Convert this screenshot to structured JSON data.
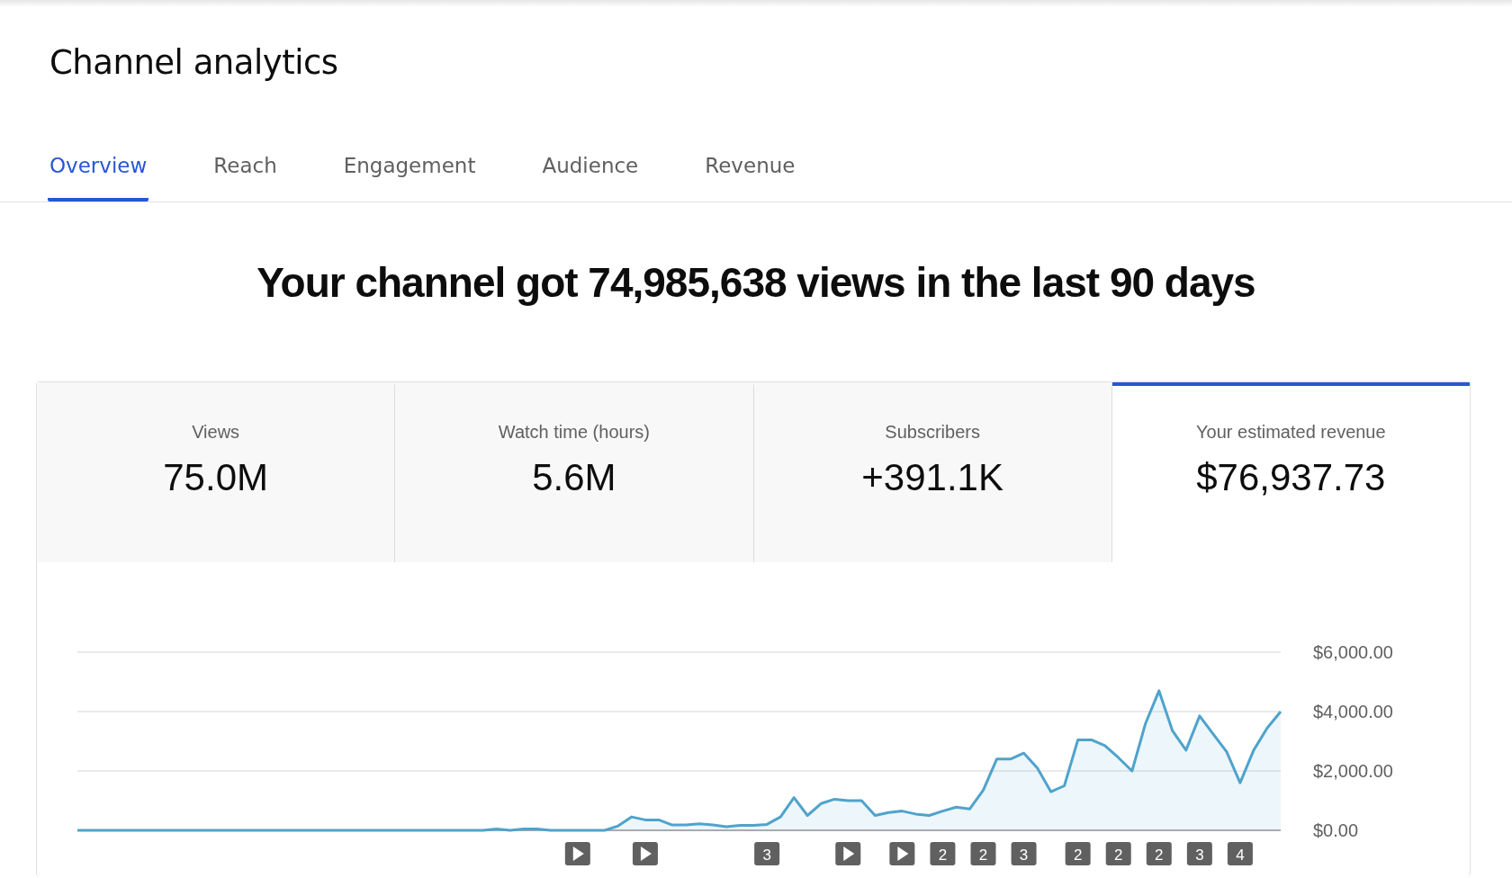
{
  "page": {
    "title": "Channel analytics"
  },
  "tabs": [
    {
      "label": "Overview",
      "selected": true
    },
    {
      "label": "Reach",
      "selected": false
    },
    {
      "label": "Engagement",
      "selected": false
    },
    {
      "label": "Audience",
      "selected": false
    },
    {
      "label": "Revenue",
      "selected": false
    }
  ],
  "headline": "Your channel got 74,985,638 views in the last 90 days",
  "metrics": [
    {
      "label": "Views",
      "value": "75.0M",
      "selected": false
    },
    {
      "label": "Watch time (hours)",
      "value": "5.6M",
      "selected": false
    },
    {
      "label": "Subscribers",
      "value": "+391.1K",
      "selected": false
    },
    {
      "label": "Your estimated revenue",
      "value": "$76,937.73",
      "selected": true
    }
  ],
  "chart": {
    "chart_data": {
      "type": "area",
      "ylim": [
        0,
        6000
      ],
      "yticks": [
        {
          "value": 0,
          "label": "$0.00"
        },
        {
          "value": 2000,
          "label": "$2,000.00"
        },
        {
          "value": 4000,
          "label": "$4,000.00"
        },
        {
          "value": 6000,
          "label": "$6,000.00"
        }
      ],
      "series": [
        {
          "color": "#4fa3cc",
          "values": [
            0,
            0,
            0,
            0,
            0,
            0,
            0,
            0,
            0,
            0,
            0,
            0,
            0,
            0,
            0,
            0,
            0,
            0,
            0,
            0,
            0,
            0,
            0,
            0,
            0,
            0,
            0,
            0,
            0,
            0,
            0,
            50,
            0,
            50,
            50,
            0,
            0,
            0,
            0,
            0,
            150,
            450,
            350,
            350,
            180,
            180,
            220,
            180,
            120,
            170,
            170,
            200,
            450,
            1100,
            500,
            900,
            1050,
            1000,
            1000,
            500,
            600,
            650,
            550,
            500,
            650,
            780,
            720,
            1350,
            2400,
            2400,
            2600,
            2100,
            1300,
            1500,
            3050,
            3050,
            2850,
            2450,
            2000,
            3600,
            4700,
            3350,
            2700,
            3850,
            3250,
            2650,
            1600,
            2700,
            3450,
            4000
          ]
        }
      ]
    },
    "markers": [
      {
        "kind": "video"
      },
      {
        "kind": "video"
      },
      {
        "kind": "count",
        "label": "3"
      },
      {
        "kind": "video"
      },
      {
        "kind": "video"
      },
      {
        "kind": "count",
        "label": "2"
      },
      {
        "kind": "count",
        "label": "2"
      },
      {
        "kind": "count",
        "label": "3"
      },
      {
        "kind": "count",
        "label": "2"
      },
      {
        "kind": "count",
        "label": "2"
      },
      {
        "kind": "count",
        "label": "2"
      },
      {
        "kind": "count",
        "label": "3"
      },
      {
        "kind": "count",
        "label": "4"
      }
    ]
  }
}
